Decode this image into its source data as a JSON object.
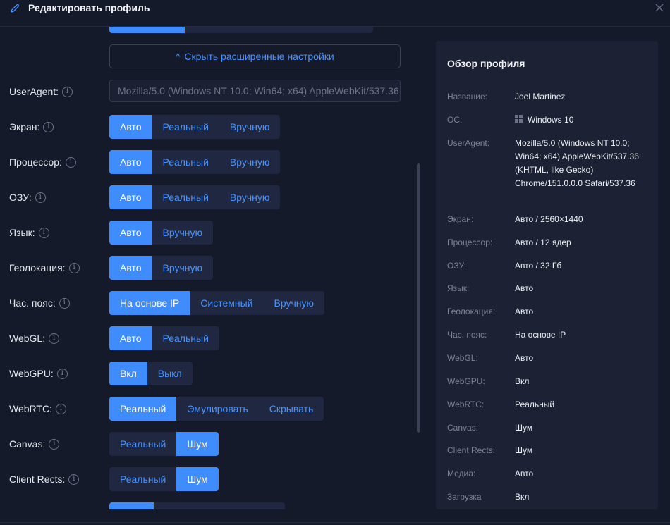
{
  "header": {
    "title": "Редактировать профиль",
    "edit_icon": "pencil-icon",
    "close_icon": "close-icon"
  },
  "advanced_toggle": {
    "label": "Скрыть расширенные настройки",
    "icon": "chevron-up-icon"
  },
  "colors": {
    "background": "#151a2a",
    "accent": "#3f8cff",
    "segment_bg": "#1f2840",
    "panel_bg": "#1c2234"
  },
  "settings": {
    "useragent": {
      "label": "UserAgent:",
      "value": "Mozilla/5.0 (Windows NT 10.0; Win64; x64) AppleWebKit/537.36 (KHTML, like Gecko) Chrome/151.0.0.0 Safari/537.36"
    },
    "screen": {
      "label": "Экран:",
      "options": [
        "Авто",
        "Реальный",
        "Вручную"
      ],
      "selected": "Авто"
    },
    "cpu": {
      "label": "Процессор:",
      "options": [
        "Авто",
        "Реальный",
        "Вручную"
      ],
      "selected": "Авто"
    },
    "ram": {
      "label": "ОЗУ:",
      "options": [
        "Авто",
        "Реальный",
        "Вручную"
      ],
      "selected": "Авто"
    },
    "language": {
      "label": "Язык:",
      "options": [
        "Авто",
        "Вручную"
      ],
      "selected": "Авто"
    },
    "geolocation": {
      "label": "Геолокация:",
      "options": [
        "Авто",
        "Вручную"
      ],
      "selected": "Авто"
    },
    "timezone": {
      "label": "Час. пояс:",
      "options": [
        "На основе IP",
        "Системный",
        "Вручную"
      ],
      "selected": "На основе IP"
    },
    "webgl": {
      "label": "WebGL:",
      "options": [
        "Авто",
        "Реальный"
      ],
      "selected": "Авто"
    },
    "webgpu": {
      "label": "WebGPU:",
      "options": [
        "Вкл",
        "Выкл"
      ],
      "selected": "Вкл"
    },
    "webrtc": {
      "label": "WebRTC:",
      "options": [
        "Реальный",
        "Эмулировать",
        "Скрывать"
      ],
      "selected": "Реальный"
    },
    "canvas": {
      "label": "Canvas:",
      "options": [
        "Реальный",
        "Шум"
      ],
      "selected": "Шум"
    },
    "client_rects": {
      "label": "Client Rects:",
      "options": [
        "Реальный",
        "Шум"
      ],
      "selected": "Шум"
    }
  },
  "overview": {
    "title": "Обзор профиля",
    "os_icon": "windows-icon",
    "rows": [
      {
        "key": "Название:",
        "value": "Joel Martinez"
      },
      {
        "key": "ОС:",
        "value": "Windows 10"
      },
      {
        "key": "UserAgent:",
        "value": "Mozilla/5.0 (Windows NT 10.0; Win64; x64) AppleWebKit/537.36 (KHTML, like Gecko) Chrome/151.0.0.0 Safari/537.36"
      },
      {
        "key": "Экран:",
        "value": "Авто / 2560×1440"
      },
      {
        "key": "Процессор:",
        "value": "Авто / 12 ядер"
      },
      {
        "key": "ОЗУ:",
        "value": "Авто / 32 Гб"
      },
      {
        "key": "Язык:",
        "value": "Авто"
      },
      {
        "key": "Геолокация:",
        "value": "Авто"
      },
      {
        "key": "Час. пояс:",
        "value": "На основе IP"
      },
      {
        "key": "WebGL:",
        "value": "Авто"
      },
      {
        "key": "WebGPU:",
        "value": "Вкл"
      },
      {
        "key": "WebRTC:",
        "value": "Реальный"
      },
      {
        "key": "Canvas:",
        "value": "Шум"
      },
      {
        "key": "Client Rects:",
        "value": "Шум"
      },
      {
        "key": "Медиа:",
        "value": "Авто"
      },
      {
        "key": "Загрузка",
        "value": "Вкл"
      }
    ]
  }
}
